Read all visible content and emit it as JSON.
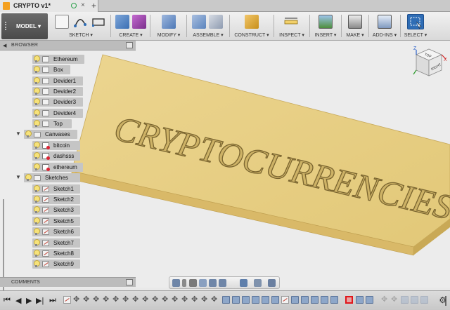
{
  "tab": {
    "title": "CRYPTO v1*",
    "close": "×",
    "new_tab": "+"
  },
  "toolbar": {
    "workspace": "MODEL ▾",
    "groups": [
      {
        "label": "SKETCH ▾"
      },
      {
        "label": "CREATE ▾"
      },
      {
        "label": "MODIFY ▾"
      },
      {
        "label": "ASSEMBLE ▾"
      },
      {
        "label": "CONSTRUCT ▾"
      },
      {
        "label": "INSPECT ▾"
      },
      {
        "label": "INSERT ▾"
      },
      {
        "label": "MAKE ▾"
      },
      {
        "label": "ADD-INS ▾"
      },
      {
        "label": "SELECT ▾"
      }
    ]
  },
  "browser": {
    "title": "BROWSER",
    "items": [
      {
        "label": "Ethereum"
      },
      {
        "label": "Box"
      },
      {
        "label": "Devider1"
      },
      {
        "label": "Devider2"
      },
      {
        "label": "Devider3"
      },
      {
        "label": "Devider4"
      },
      {
        "label": "Top"
      }
    ],
    "canvases": {
      "label": "Canvases",
      "items": [
        {
          "label": "bitcoin"
        },
        {
          "label": "dashsss"
        },
        {
          "label": "ethereum"
        }
      ]
    },
    "sketches": {
      "label": "Sketches",
      "items": [
        {
          "label": "Sketch1"
        },
        {
          "label": "Sketch2"
        },
        {
          "label": "Sketch3"
        },
        {
          "label": "Sketch5"
        },
        {
          "label": "Sketch6"
        },
        {
          "label": "Sketch7"
        },
        {
          "label": "Sketch8"
        },
        {
          "label": "Sketch9"
        }
      ]
    }
  },
  "comments": {
    "title": "COMMENTS"
  },
  "model": {
    "engraved_text": "CRYPTOCURRENCIES",
    "plate_color": "#e8cf86"
  },
  "viewcube": {
    "face_top": "TOP",
    "face_right": "RIGHT",
    "axis_x": "X",
    "axis_z": "Z"
  },
  "timeline": {
    "play_first": "⏮",
    "play_prev": "◀",
    "play": "▶",
    "play_next": "▶|",
    "play_last": "⏭",
    "settings": "⚙"
  },
  "colors": {
    "accent": "#2f6db5",
    "selected": "#e0161b"
  }
}
